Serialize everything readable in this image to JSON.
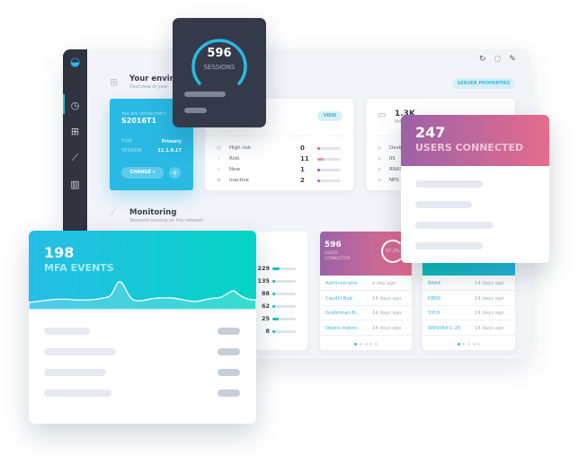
{
  "colors": {
    "accent": "#29b9e3",
    "dark": "#343a4a",
    "pink_gradient": [
      "#9c62a8",
      "#e56c8c"
    ],
    "teal_gradient": [
      "#26bde6",
      "#05d4c4"
    ]
  },
  "toolbar": {
    "icons": [
      "refresh-icon",
      "chat-icon",
      "wrench-icon"
    ],
    "server_properties": "SERVER PROPERTIES"
  },
  "environment": {
    "title": "Your enviro",
    "subtitle": "Overview of your",
    "connected_label": "You are connected t",
    "server": "S2016T1",
    "type_label": "TYPE",
    "type_value": "Primary",
    "version_label": "VERSION",
    "version_value": "11.1.0.17",
    "change_label": "CHANGE",
    "add": "+"
  },
  "risk": {
    "view_label": "VIEW",
    "rows": [
      {
        "label": "High risk",
        "value": "0",
        "fill": 0.05,
        "color": "#e65a8a"
      },
      {
        "label": "Risk",
        "value": "11",
        "fill": 0.25,
        "color": "#e993b1"
      },
      {
        "label": "New",
        "value": "1",
        "fill": 0.05,
        "color": "#a64ba8"
      },
      {
        "label": "Inactive",
        "value": "2",
        "fill": 0.05,
        "color": "#b86bb8"
      }
    ]
  },
  "machines": {
    "value": "1.3K",
    "label": "MA",
    "rows": [
      "Desk",
      "IIS",
      "RRAS",
      "NPS"
    ]
  },
  "monitoring": {
    "title": "Monitoring",
    "subtitle": "Sessions running on the network"
  },
  "sessions_card": {
    "value": "596",
    "label": "SESSIONS",
    "gauge": 0.7
  },
  "users_overlay": {
    "value": "247",
    "label": "USERS CONNECTED"
  },
  "mfa": {
    "value": "198",
    "label": "MFA EVENTS"
  },
  "counts": [
    {
      "value": "229",
      "fill": 0.3
    },
    {
      "value": "135",
      "fill": 0.05
    },
    {
      "value": "88",
      "fill": 0.05
    },
    {
      "value": "62",
      "fill": 0.05
    },
    {
      "value": "25",
      "fill": 0.28
    },
    {
      "value": "8",
      "fill": 0.05
    }
  ],
  "users_card": {
    "value": "596",
    "label1": "USERS",
    "label2": "CONNECTED",
    "percent": "57.2%",
    "rows": [
      {
        "name": "Administrator",
        "time": "a day ago"
      },
      {
        "name": "Caudill Bob",
        "time": "14 days ago"
      },
      {
        "name": "Grafenhan B...",
        "time": "14 days ago"
      },
      {
        "name": "Objois Indere...",
        "time": "14 days ago"
      }
    ]
  },
  "machines_card": {
    "rows": [
      {
        "name": "BRA4",
        "time": "14 days ago"
      },
      {
        "name": "KENS",
        "time": "14 days ago"
      },
      {
        "name": "SYC6",
        "time": "14 days ago"
      },
      {
        "name": "WKS064-C-25",
        "time": "14 days ago"
      }
    ]
  }
}
